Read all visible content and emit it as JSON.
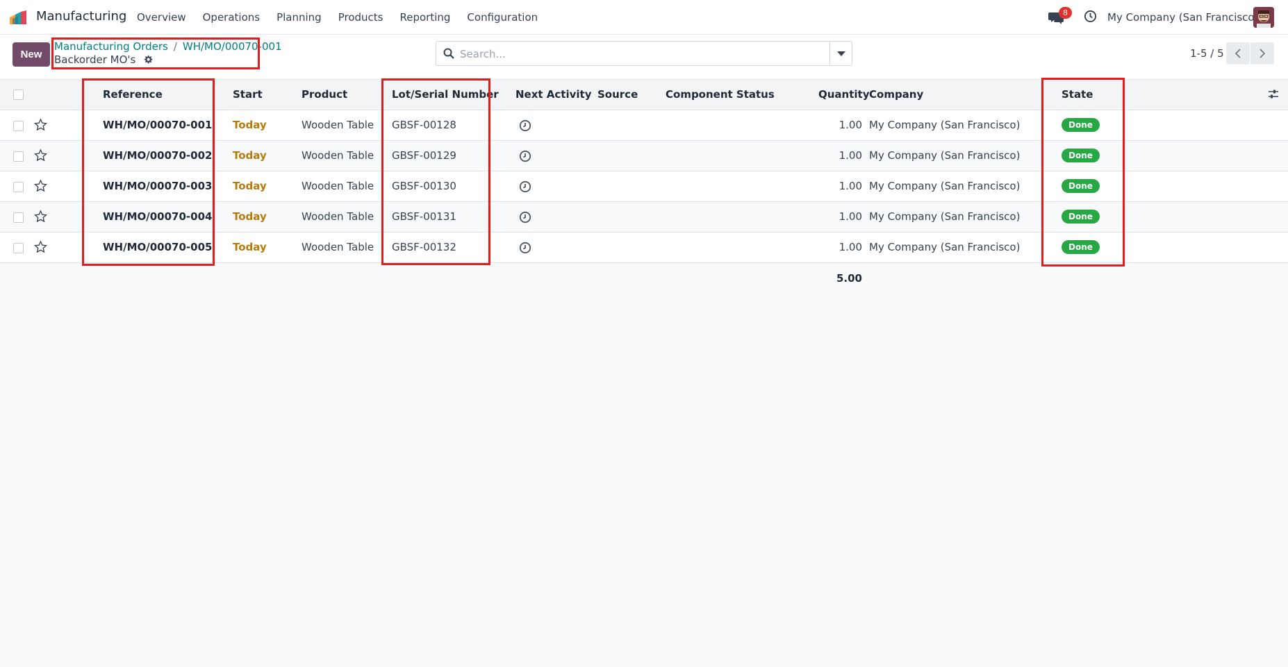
{
  "app": {
    "name": "Manufacturing",
    "menu": [
      "Overview",
      "Operations",
      "Planning",
      "Products",
      "Reporting",
      "Configuration"
    ]
  },
  "systray": {
    "messages_count": "8",
    "company": "My Company (San Francisco)"
  },
  "control_panel": {
    "new_label": "New",
    "breadcrumb": [
      "Manufacturing Orders",
      "WH/MO/00070-001"
    ],
    "subtitle": "Backorder MO's",
    "search_placeholder": "Search...",
    "pager": "1-5 / 5"
  },
  "table": {
    "columns": [
      "Reference",
      "Start",
      "Product",
      "Lot/Serial Number",
      "Next Activity",
      "Source",
      "Component Status",
      "Quantity",
      "Company",
      "State"
    ],
    "rows": [
      {
        "reference": "WH/MO/00070-001",
        "start": "Today",
        "product": "Wooden Table",
        "lot": "GBSF-00128",
        "source": "",
        "component_status": "",
        "quantity": "1.00",
        "company": "My Company (San Francisco)",
        "state": "Done"
      },
      {
        "reference": "WH/MO/00070-002",
        "start": "Today",
        "product": "Wooden Table",
        "lot": "GBSF-00129",
        "source": "",
        "component_status": "",
        "quantity": "1.00",
        "company": "My Company (San Francisco)",
        "state": "Done"
      },
      {
        "reference": "WH/MO/00070-003",
        "start": "Today",
        "product": "Wooden Table",
        "lot": "GBSF-00130",
        "source": "",
        "component_status": "",
        "quantity": "1.00",
        "company": "My Company (San Francisco)",
        "state": "Done"
      },
      {
        "reference": "WH/MO/00070-004",
        "start": "Today",
        "product": "Wooden Table",
        "lot": "GBSF-00131",
        "source": "",
        "component_status": "",
        "quantity": "1.00",
        "company": "My Company (San Francisco)",
        "state": "Done"
      },
      {
        "reference": "WH/MO/00070-005",
        "start": "Today",
        "product": "Wooden Table",
        "lot": "GBSF-00132",
        "source": "",
        "component_status": "",
        "quantity": "1.00",
        "company": "My Company (San Francisco)",
        "state": "Done"
      }
    ],
    "quantity_total": "5.00"
  },
  "colors": {
    "primary": "#714b67",
    "link": "#017e84",
    "today": "#b57a0b",
    "done_badge": "#28a745",
    "highlight": "#e11d1d"
  }
}
